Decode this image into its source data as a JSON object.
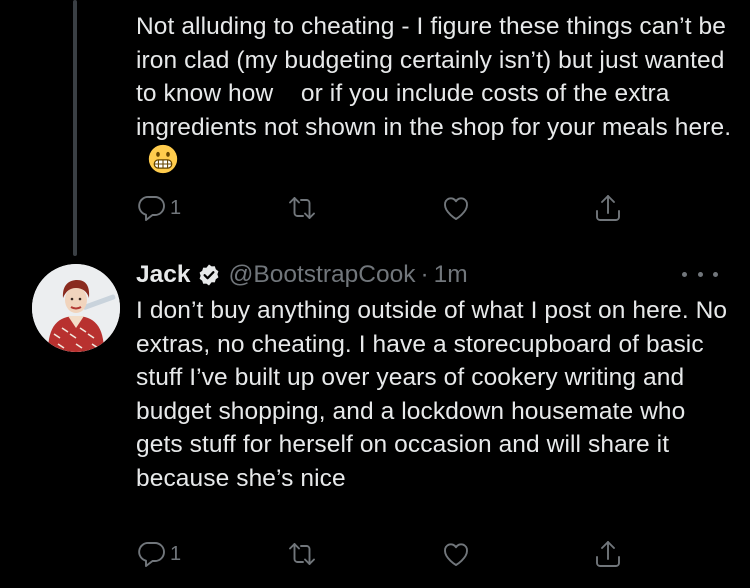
{
  "thread_parent": {
    "text": "Not alluding to cheating - I figure these things can’t be iron clad (my budgeting certainly isn’t) but just wanted to know how    or if you include costs of the extra ingredients not shown in the shop for your meals here.",
    "emoji": "grimacing-face",
    "actions": {
      "reply_count": "1",
      "retweet_count": "",
      "like_count": "",
      "share": ""
    }
  },
  "reply": {
    "author": {
      "name": "Jack",
      "verified": true,
      "handle": "@BootstrapCook",
      "separator": "·",
      "time": "1m"
    },
    "text": "I don’t buy anything outside of what I post on here. No extras, no cheating. I have a storecupboard of basic stuff I’ve built up over years of cookery writing and budget shopping, and a lockdown housemate who gets stuff for herself on occasion and will share it because she’s nice",
    "actions": {
      "reply_count": "1",
      "retweet_count": "",
      "like_count": "",
      "share": ""
    }
  },
  "colors": {
    "background": "#000000",
    "text_primary": "#e7e9ea",
    "text_secondary": "#71767b",
    "thread_line": "#3a3f44",
    "verified_badge": "#e7e9ea"
  }
}
